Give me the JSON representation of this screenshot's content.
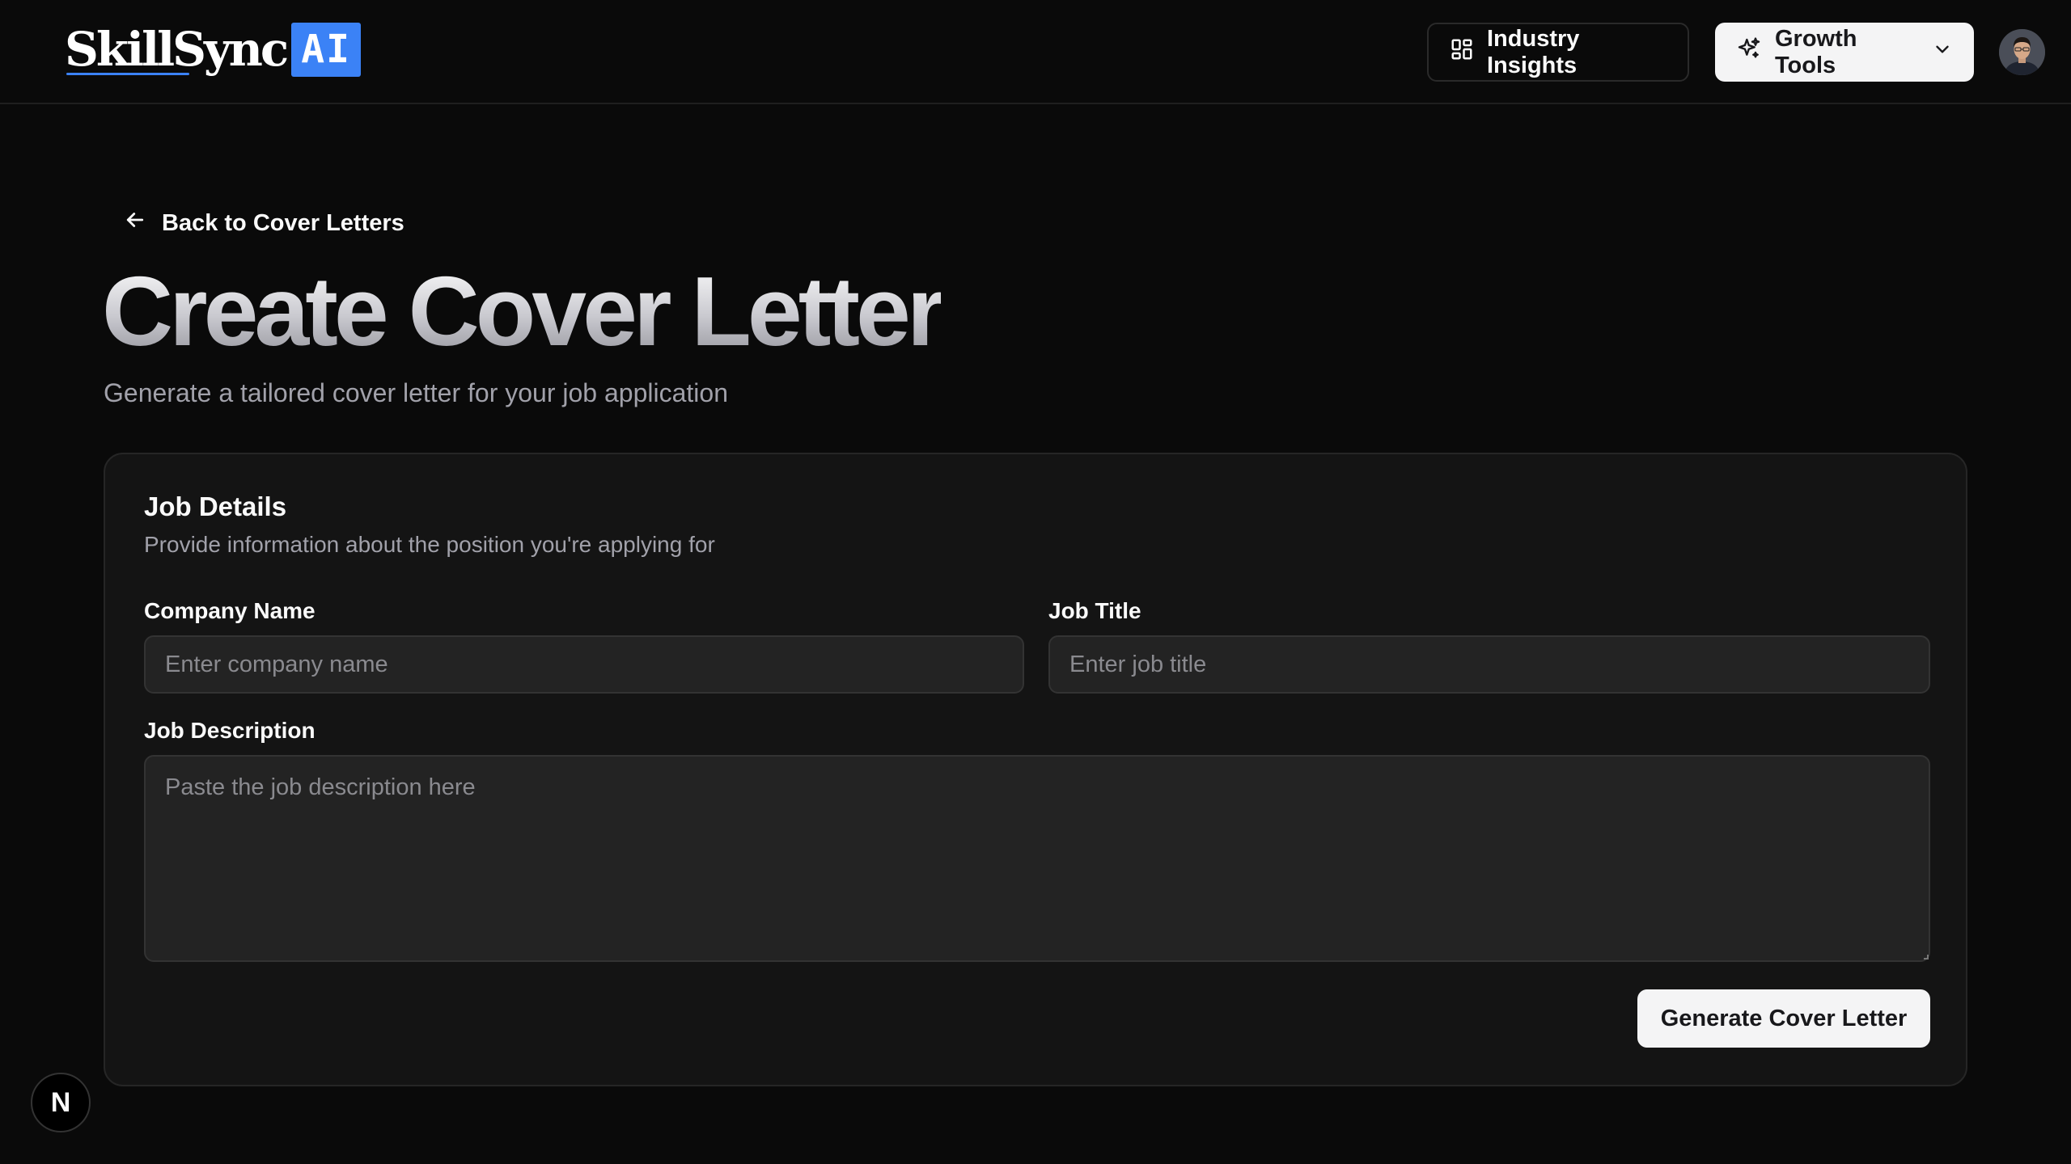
{
  "header": {
    "logo_text": "SkillSync",
    "logo_badge": "AI",
    "industry_insights_label": "Industry Insights",
    "growth_tools_label": "Growth Tools"
  },
  "page": {
    "back_link_label": "Back to Cover Letters",
    "title": "Create Cover Letter",
    "subtitle": "Generate a tailored cover letter for your job application"
  },
  "form": {
    "card_title": "Job Details",
    "card_description": "Provide information about the position you're applying for",
    "company_name": {
      "label": "Company Name",
      "placeholder": "Enter company name",
      "value": ""
    },
    "job_title": {
      "label": "Job Title",
      "placeholder": "Enter job title",
      "value": ""
    },
    "job_description": {
      "label": "Job Description",
      "placeholder": "Paste the job description here",
      "value": ""
    },
    "submit_label": "Generate Cover Letter"
  },
  "dev_badge": {
    "letter": "N"
  },
  "colors": {
    "background": "#0a0a0a",
    "card": "#141414",
    "input": "#232323",
    "accent": "#3b82f6",
    "button_light": "#f4f4f5"
  }
}
